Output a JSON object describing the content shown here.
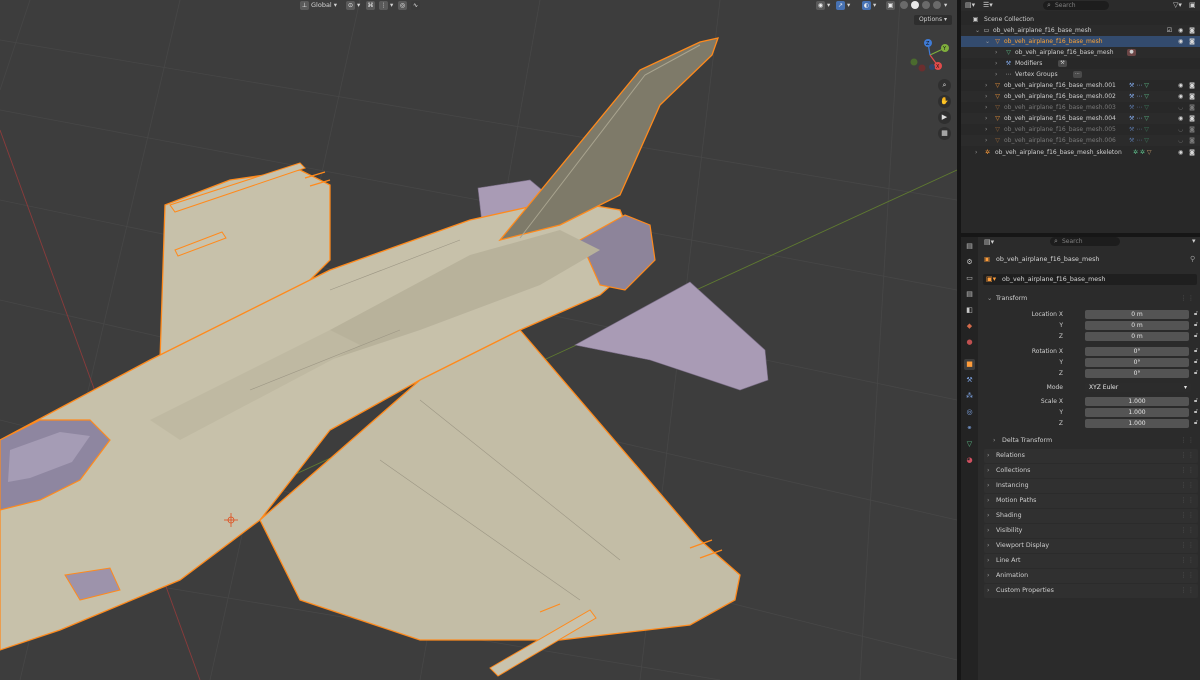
{
  "viewport": {
    "header": {
      "orientation_label": "Global",
      "options_label": "Options"
    },
    "gizmo": {
      "x": "X",
      "y": "Y",
      "z": "Z"
    },
    "nav_icons": [
      "zoom-icon",
      "pan-hand-icon",
      "camera-icon",
      "grid-perspective-icon"
    ]
  },
  "outliner": {
    "search_placeholder": "Search",
    "rows": [
      {
        "label": "Scene Collection",
        "state": "normal"
      },
      {
        "label": "ob_veh_airplane_f16_base_mesh",
        "state": "normal"
      },
      {
        "label": "ob_veh_airplane_f16_base_mesh",
        "state": "selected"
      },
      {
        "label": "ob_veh_airplane_f16_base_mesh",
        "state": "normal"
      },
      {
        "label": "Modifiers",
        "state": "normal"
      },
      {
        "label": "Vertex Groups",
        "state": "normal"
      },
      {
        "label": "ob_veh_airplane_f16_base_mesh.001",
        "state": "normal"
      },
      {
        "label": "ob_veh_airplane_f16_base_mesh.002",
        "state": "normal"
      },
      {
        "label": "ob_veh_airplane_f16_base_mesh.003",
        "state": "dim"
      },
      {
        "label": "ob_veh_airplane_f16_base_mesh.004",
        "state": "normal"
      },
      {
        "label": "ob_veh_airplane_f16_base_mesh.005",
        "state": "dim"
      },
      {
        "label": "ob_veh_airplane_f16_base_mesh.006",
        "state": "dim"
      },
      {
        "label": "ob_veh_airplane_f16_base_mesh_skeleton",
        "state": "normal"
      }
    ]
  },
  "properties": {
    "search_placeholder": "Search",
    "object_name": "ob_veh_airplane_f16_base_mesh",
    "object_datablock": "ob_veh_airplane_f16_base_mesh",
    "transform": {
      "title": "Transform",
      "location_label": "Location X",
      "location": [
        "0 m",
        "0 m",
        "0 m"
      ],
      "rotation_label": "Rotation X",
      "rotation": [
        "0°",
        "0°",
        "0°"
      ],
      "mode_label": "Mode",
      "mode_value": "XYZ Euler",
      "scale_label": "Scale X",
      "scale": [
        "1.000",
        "1.000",
        "1.000"
      ],
      "axis_y": "Y",
      "axis_z": "Z",
      "delta": "Delta Transform"
    },
    "sections": [
      "Relations",
      "Collections",
      "Instancing",
      "Motion Paths",
      "Shading",
      "Visibility",
      "Viewport Display",
      "Line Art",
      "Animation",
      "Custom Properties"
    ]
  },
  "colors": {
    "viewport_bg": "#3d3d3d",
    "selection_orange": "#ff8a1c",
    "mesh_body": "#c7c1aa",
    "mesh_canopy": "#a99bb5"
  }
}
